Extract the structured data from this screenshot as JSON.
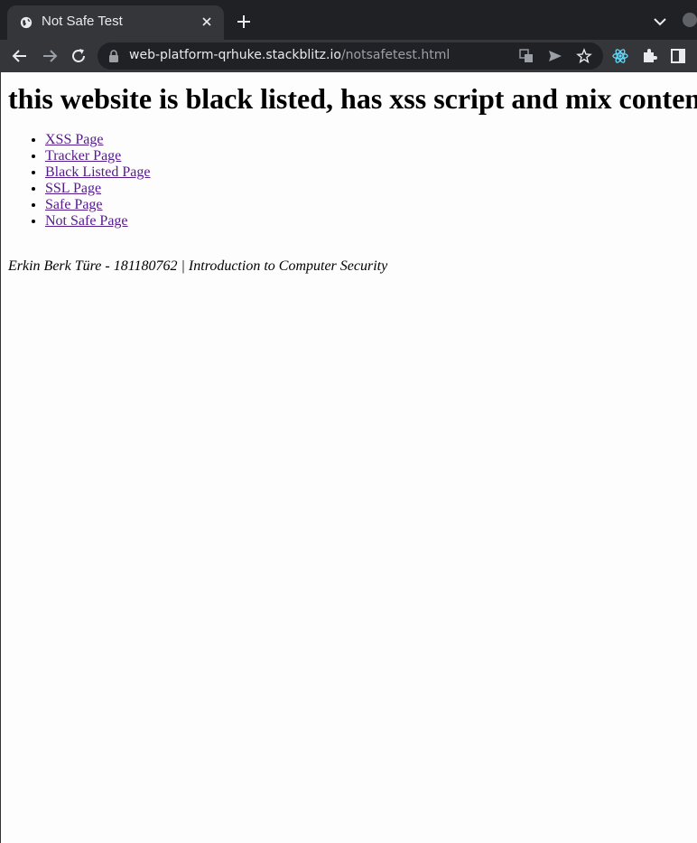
{
  "browser": {
    "tab_title": "Not Safe Test",
    "url_host": "web-platform-qrhuke.stackblitz.io",
    "url_path": "/notsafetest.html"
  },
  "page": {
    "heading": "this website is black listed, has xss script and mix content",
    "links": [
      "XSS Page",
      "Tracker Page",
      "Black Listed Page",
      "SSL Page",
      "Safe Page",
      "Not Safe Page"
    ],
    "footer": "Erkin Berk Türe - 181180762 | Introduction to Computer Security"
  },
  "colors": {
    "chrome_bg": "#202124",
    "toolbar_bg": "#35363a",
    "link_visited": "#551a8b"
  },
  "icons": [
    "globe-icon",
    "close-icon",
    "plus-icon",
    "chevron-down-icon",
    "back-arrow-icon",
    "forward-arrow-icon",
    "reload-icon",
    "lock-icon",
    "translate-icon",
    "send-icon",
    "star-icon",
    "react-icon",
    "puzzle-icon",
    "side-panel-icon"
  ]
}
